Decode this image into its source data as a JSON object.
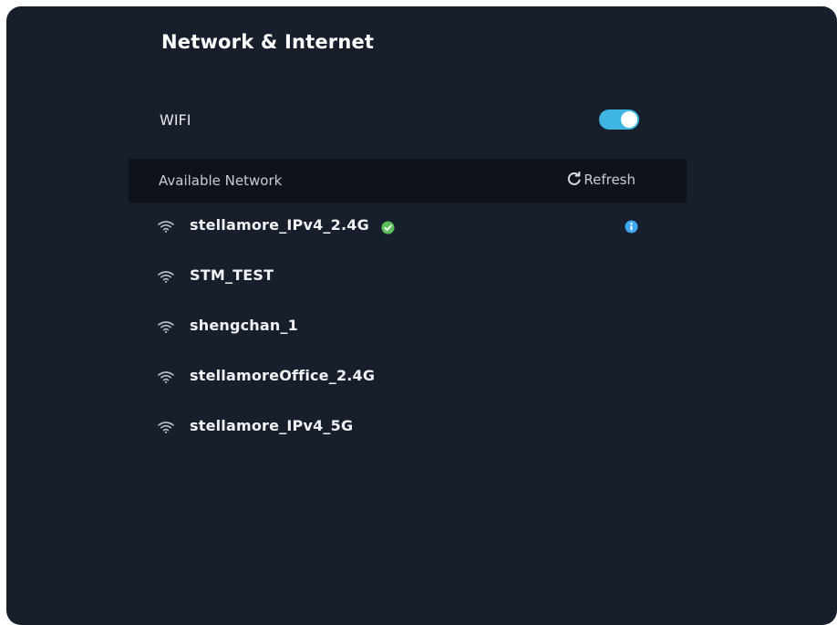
{
  "page": {
    "title": "Network & Internet"
  },
  "wifi": {
    "label": "WIFI",
    "enabled": true,
    "toggle_color": "#3fb6e2"
  },
  "available": {
    "title": "Available Network",
    "refresh_label": "Refresh",
    "refresh_icon": "refresh-icon"
  },
  "networks": [
    {
      "name": "stellamore_IPv4_2.4G",
      "connected": true,
      "has_info": true
    },
    {
      "name": "STM_TEST",
      "connected": false,
      "has_info": false
    },
    {
      "name": "shengchan_1",
      "connected": false,
      "has_info": false
    },
    {
      "name": "stellamoreOffice_2.4G",
      "connected": false,
      "has_info": false
    },
    {
      "name": "stellamore_IPv4_5G",
      "connected": false,
      "has_info": false
    }
  ],
  "colors": {
    "background": "#171e2c",
    "header_band": "#0e121b",
    "connected_green": "#5bbf5a",
    "info_blue": "#3fa9f0"
  }
}
